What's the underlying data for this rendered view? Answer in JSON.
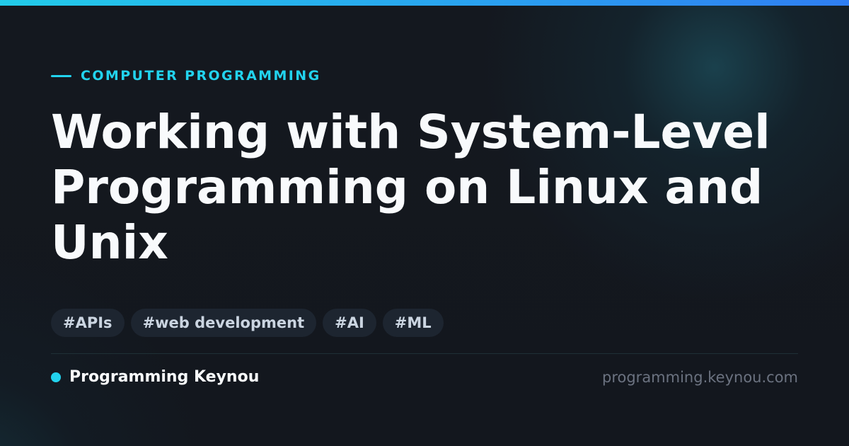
{
  "colors": {
    "accent": "#22d3ee",
    "top_bar_start": "#22cbe9",
    "top_bar_end": "#2f7ef2",
    "background": "#13171e",
    "title": "#f8fafc",
    "tag_background": "#1d2530",
    "tag_text": "#cbd5e1",
    "url_text": "#6b7280"
  },
  "category": {
    "label": "COMPUTER PROGRAMMING"
  },
  "title": "Working with System-Level Programming on Linux and Unix",
  "tags": [
    {
      "label": "#APIs"
    },
    {
      "label": "#web development"
    },
    {
      "label": "#AI"
    },
    {
      "label": "#ML"
    }
  ],
  "footer": {
    "brand_name": "Programming Keynou",
    "site_url": "programming.keynou.com"
  }
}
